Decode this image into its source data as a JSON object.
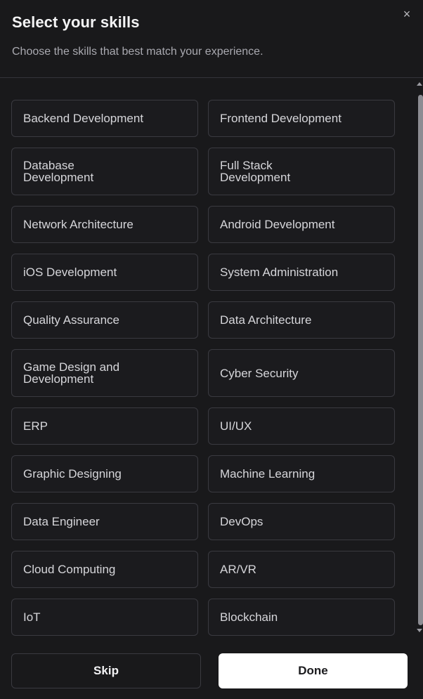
{
  "dialog": {
    "title": "Select your skills",
    "subtitle": "Choose the skills that best match your experience.",
    "close_icon": "×"
  },
  "skills": [
    [
      "Backend Development",
      "Frontend Development"
    ],
    [
      "Database Development",
      "Full Stack Development"
    ],
    [
      "Network Architecture",
      "Android Development"
    ],
    [
      "iOS Development",
      "System Administration"
    ],
    [
      "Quality Assurance",
      "Data Architecture"
    ],
    [
      "Game Design and Development",
      "Cyber Security"
    ],
    [
      "ERP",
      "UI/UX"
    ],
    [
      "Graphic Designing",
      "Machine Learning"
    ],
    [
      "Data Engineer",
      "DevOps"
    ],
    [
      "Cloud Computing",
      "AR/VR"
    ],
    [
      "IoT",
      "Blockchain"
    ]
  ],
  "buttons": {
    "skip": "Skip",
    "done": "Done"
  },
  "colors": {
    "background": "#19191b",
    "chip_border": "#3a3a40",
    "primary_button": "#ffffff"
  }
}
